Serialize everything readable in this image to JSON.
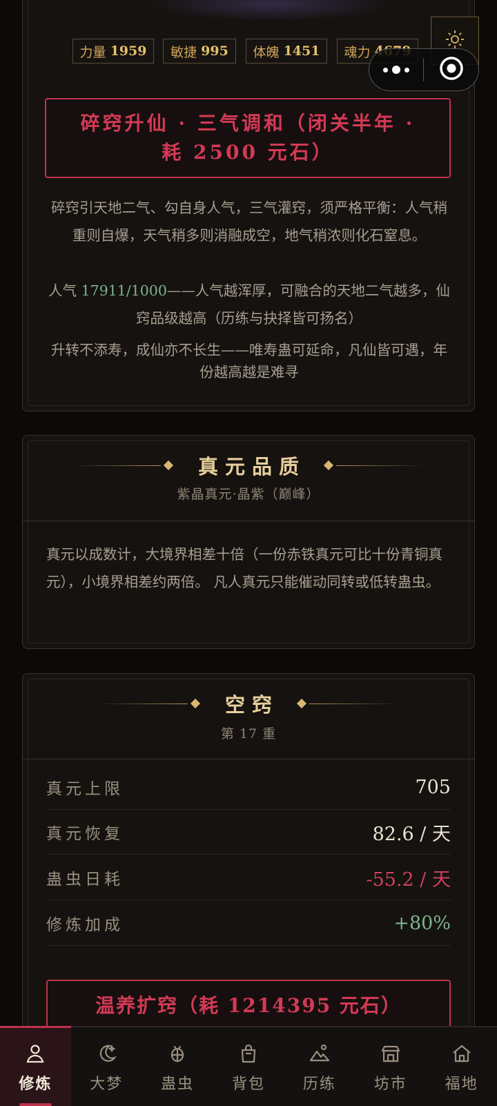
{
  "stats": [
    {
      "label": "力量",
      "value": "1959"
    },
    {
      "label": "敏捷",
      "value": "995"
    },
    {
      "label": "体魄",
      "value": "1451"
    },
    {
      "label": "魂力",
      "value": "4679"
    }
  ],
  "ascend": {
    "line1": "碎窍升仙 · 三气调和（闭关半年 ·",
    "line2": "耗 2500 元石）"
  },
  "desc": {
    "p1": "碎窍引天地二气、勾自身人气，三气灌窍，须严格平衡：人气稍重则自爆，天气稍多则消融成空，地气稍浓则化石窒息。",
    "p2_prefix": "人气 ",
    "p2_value": "17911/1000",
    "p2_suffix": "——人气越浑厚，可融合的天地二气越多，仙窍品级越高（历练与抉择皆可扬名）",
    "p3": "升转不添寿，成仙亦不长生——唯寿蛊可延命，凡仙皆可遇，年份越高越是难寻"
  },
  "quality": {
    "title": "真元品质",
    "subtitle": "紫晶真元·晶紫（巅峰）",
    "body": "真元以成数计，大境界相差十倍（一份赤铁真元可比十份青铜真元），小境界相差约两倍。 凡人真元只能催动同转或低转蛊虫。"
  },
  "aperture": {
    "title": "空窍",
    "subtitle": "第 17 重",
    "rows": [
      {
        "label": "真元上限",
        "value": "705"
      },
      {
        "label": "真元恢复",
        "value": "82.6 / 天"
      },
      {
        "label": "蛊虫日耗",
        "value": "-55.2 / 天"
      },
      {
        "label": "修炼加成",
        "value": "+80%"
      }
    ],
    "button": "温养扩窍（耗 1214395 元石）"
  },
  "nav": [
    {
      "label": "修炼",
      "icon": "person-icon",
      "active": true
    },
    {
      "label": "大梦",
      "icon": "moon-icon"
    },
    {
      "label": "蛊虫",
      "icon": "bug-icon"
    },
    {
      "label": "背包",
      "icon": "bag-icon"
    },
    {
      "label": "历练",
      "icon": "mountain-icon"
    },
    {
      "label": "坊市",
      "icon": "shop-icon"
    },
    {
      "label": "福地",
      "icon": "home-icon"
    }
  ],
  "colors": {
    "accent_red": "#c0334c",
    "gold": "#e4c06a",
    "green": "#7eb48d",
    "background": "#0b0a09"
  }
}
